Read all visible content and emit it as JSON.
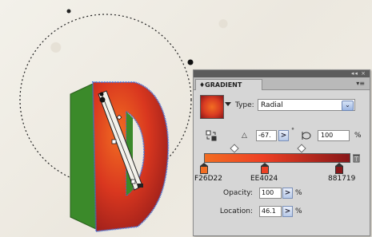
{
  "panel": {
    "title": "GRADIENT",
    "top_controls": "◂◂ ×",
    "menu_icon": "▾≡",
    "type_label": "Type:",
    "type_value": "Radial",
    "type_arrow": "⌄",
    "angle_value": "-67.",
    "degree_symbol": "°",
    "aspect_value": "100",
    "percent": "%",
    "step_arrow": ">",
    "stops": [
      {
        "label": "F26D22",
        "color": "#f26d22"
      },
      {
        "label": "EE4024",
        "color": "#ee4024"
      },
      {
        "label": "881719",
        "color": "#881719"
      }
    ],
    "opacity_label": "Opacity:",
    "opacity_value": "100",
    "location_label": "Location:",
    "location_value": "46.1"
  },
  "colors": {
    "panel_bg": "#d6d6d6",
    "titlebar": "#5c5c5c",
    "letter_front_light": "#f26d22",
    "letter_front_dark": "#b11f1d",
    "letter_side": "#3b8a2a",
    "selection_blue": "#3a6fe0"
  },
  "icons": [
    "reverse-gradient-icon",
    "angle-icon",
    "aspect-ratio-icon",
    "delete-stop-icon",
    "dropdown-arrow-icon"
  ]
}
